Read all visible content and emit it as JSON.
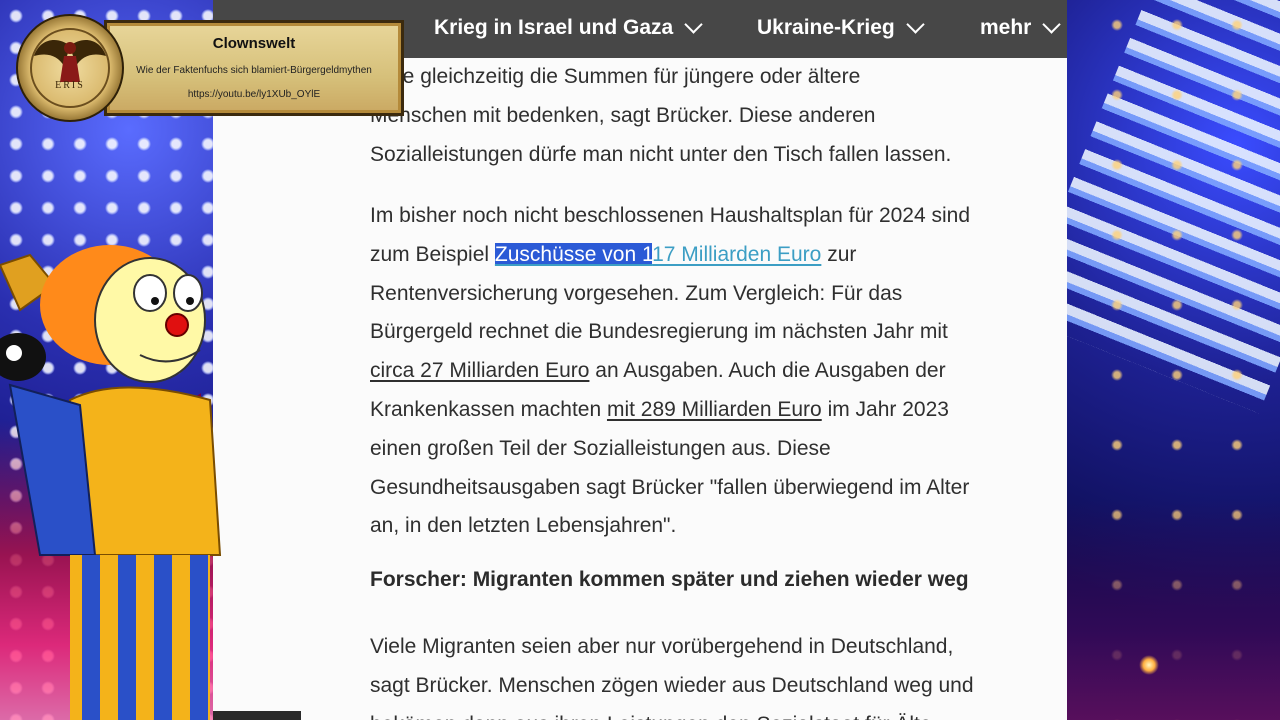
{
  "nav": {
    "items": [
      {
        "label": "Krieg in Israel und Gaza"
      },
      {
        "label": "Ukraine-Krieg"
      },
      {
        "label": "mehr"
      }
    ]
  },
  "article": {
    "p1": {
      "l1": "üsse gleichzeitig die Summen für jüngere oder ältere",
      "l2": "Menschen mit bedenken, sagt Brücker. Diese anderen",
      "l3": "Sozialleistungen dürfe man nicht unter den Tisch fallen lassen."
    },
    "p2": {
      "l1": "Im bisher noch nicht beschlossenen Haushaltsplan für 2024 sind",
      "l2_pre": "zum Beispiel ",
      "link1_selected": "Zuschüsse von 1",
      "link1_rest": "17 Milliarden Euro",
      "l2_post": " zur",
      "l3": "Rentenversicherung vorgesehen. Zum Vergleich: Für das",
      "l4": "Bürgergeld rechnet die Bundesregierung im nächsten Jahr mit",
      "link2": "circa 27 Milliarden Euro",
      "l5_post": " an Ausgaben. Auch die Ausgaben der",
      "l6_pre": "Krankenkassen machten ",
      "link3": "mit 289 Milliarden Euro",
      "l6_post": " im Jahr 2023",
      "l7": "einen großen Teil der Sozialleistungen aus. Diese",
      "l8": "Gesundheitsausgaben sagt Brücker \"fallen überwiegend im Alter",
      "l9": "an, in den letzten Lebensjahren\"."
    },
    "subheading": "Forscher: Migranten kommen später und ziehen wieder weg",
    "p3": {
      "l1": "Viele Migranten seien aber nur vorübergehend in Deutschland,",
      "l2": "sagt Brücker. Menschen zögen wieder aus Deutschland weg und",
      "l3": "bekämen dann aus ihren Leistungen den Sozialstaat für Älte"
    }
  },
  "overlay": {
    "title": "Clownswelt",
    "subtitle": "Wie der Faktenfuchs sich blamiert-Bürgergeldmythen",
    "url": "https://youtu.be/ly1XUb_OYlE",
    "logo_text": "ERIS"
  },
  "colors": {
    "nav_bg": "#474747",
    "link_blue": "#3c9ec4",
    "selection": "#2b5ad6",
    "text": "#2f2f2f"
  }
}
